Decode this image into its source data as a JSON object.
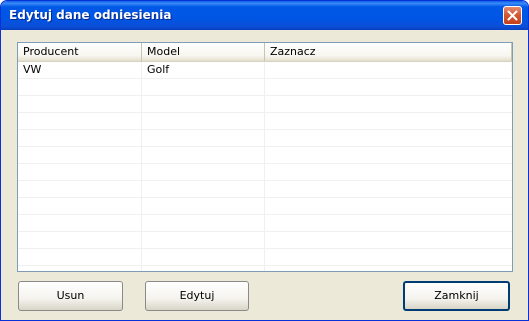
{
  "window": {
    "title": "Edytuj dane odniesienia"
  },
  "table": {
    "columns": [
      "Producent",
      "Model",
      "Zaznacz"
    ],
    "rows": [
      [
        "VW",
        "Golf",
        ""
      ]
    ]
  },
  "buttons": {
    "delete_label": "Usun",
    "edit_label": "Edytuj",
    "close_label": "Zamknij"
  },
  "colors": {
    "titlebar": "#0055e5",
    "window_bg": "#ece9d8",
    "close_button": "#d35a34"
  }
}
